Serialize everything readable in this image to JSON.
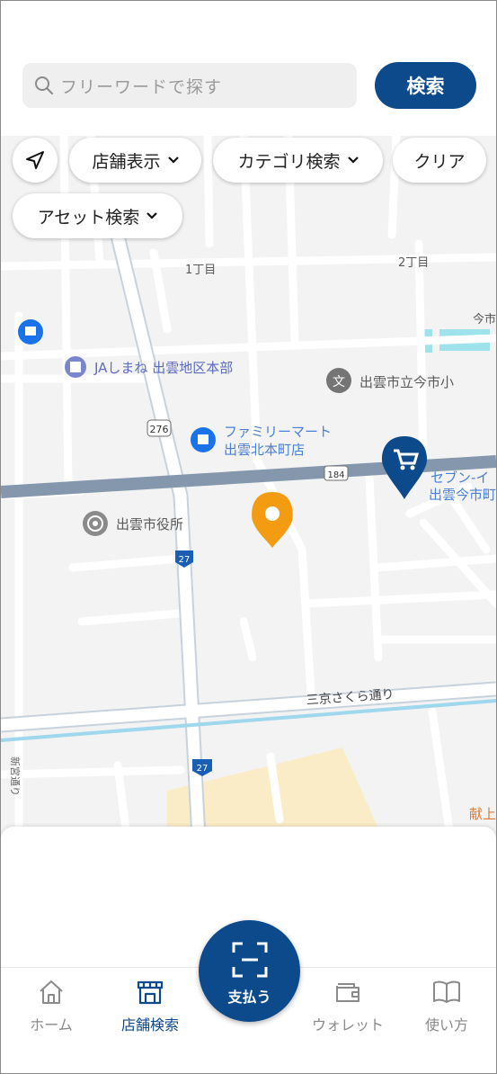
{
  "search": {
    "placeholder": "フリーワードで探す",
    "button_label": "検索"
  },
  "filters": {
    "store_display": "店舗表示",
    "category_search": "カテゴリ検索",
    "clear": "クリア",
    "asset_search": "アセット検索"
  },
  "map": {
    "labels": {
      "chome1": "1丁目",
      "chome2": "2丁目",
      "ima": "今市",
      "ja": "JAしまね 出雲地区本部",
      "school": "出雲市立今市小",
      "familymart_1": "ファミリーマート",
      "familymart_2": "出雲北本町店",
      "seven_1": "セブン-イ",
      "seven_2": "出雲今市町",
      "city_hall": "出雲市役所",
      "sankyo_street": "三京さくら通り",
      "route_276": "276",
      "route_184": "184",
      "route_27a": "27",
      "route_27b": "27",
      "side_road": "新宮通り",
      "kenjo": "献上"
    }
  },
  "nav": {
    "home": "ホーム",
    "store_search": "店舗検索",
    "pay": "支払う",
    "wallet": "ウォレット",
    "howto": "使い方"
  },
  "colors": {
    "brand": "#0c4a8c",
    "pin_orange": "#f39c12",
    "road_main": "#8497ad"
  }
}
